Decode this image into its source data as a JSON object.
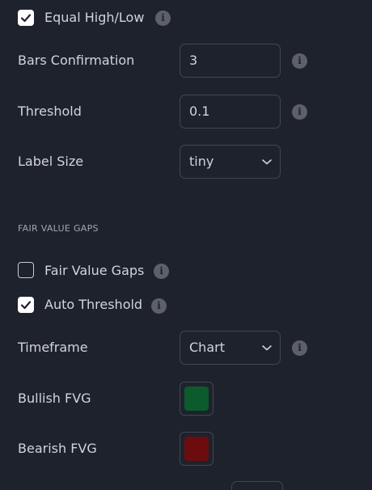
{
  "equal_high_low": {
    "label": "Equal High/Low",
    "checked": true
  },
  "bars_confirmation": {
    "label": "Bars Confirmation",
    "value": "3"
  },
  "threshold": {
    "label": "Threshold",
    "value": "0.1"
  },
  "label_size": {
    "label": "Label Size",
    "value": "tiny"
  },
  "fvg_section": {
    "title": "FAIR VALUE GAPS"
  },
  "fair_value_gaps": {
    "label": "Fair Value Gaps",
    "checked": false
  },
  "auto_threshold": {
    "label": "Auto Threshold",
    "checked": true
  },
  "timeframe": {
    "label": "Timeframe",
    "value": "Chart"
  },
  "bullish_fvg": {
    "label": "Bullish FVG",
    "color": "#0b5b2c"
  },
  "bearish_fvg": {
    "label": "Bearish FVG",
    "color": "#6d0c0f"
  },
  "colors": {
    "background": "#1e222d",
    "border": "#434651",
    "text": "#d1d4dc",
    "info": "#5d606b"
  }
}
